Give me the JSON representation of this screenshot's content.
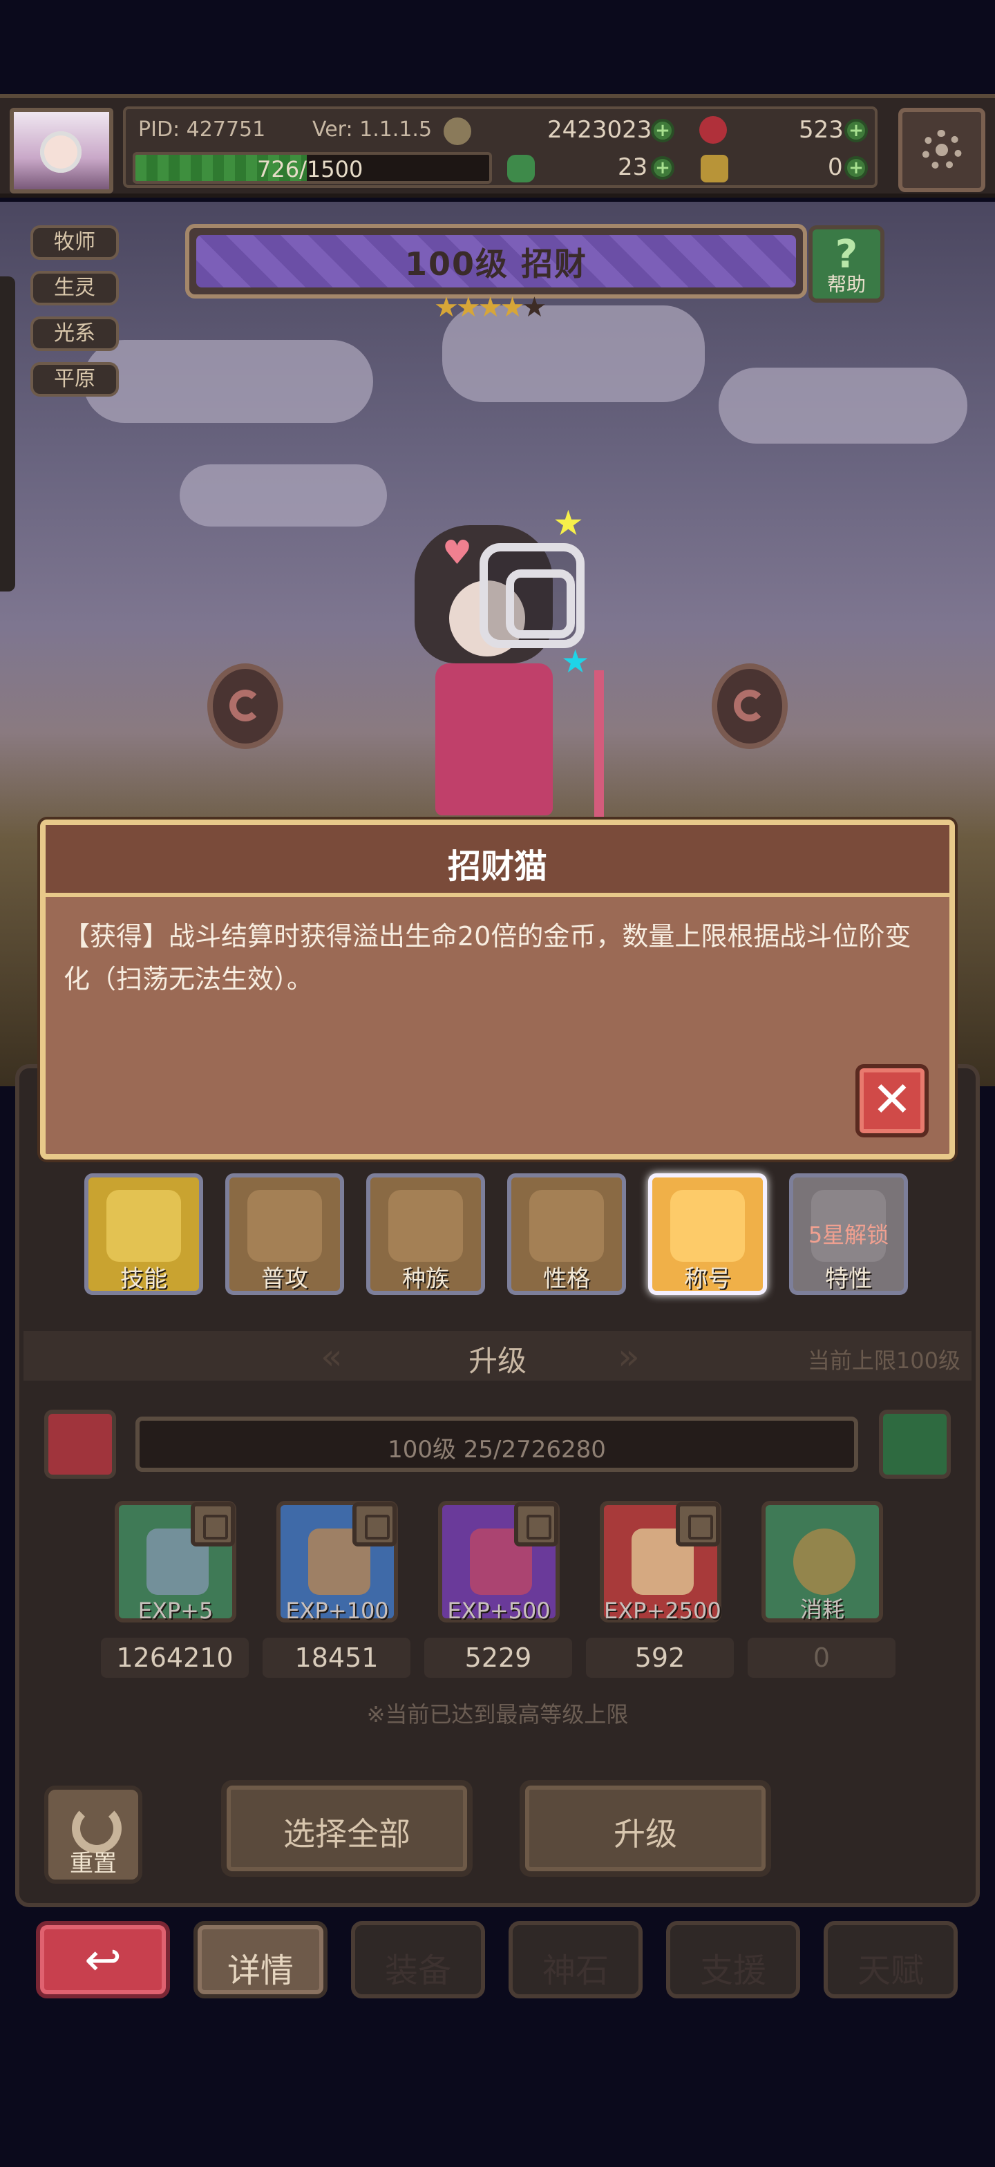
{
  "header": {
    "pid": "PID: 427751",
    "version": "Ver: 1.1.1.5",
    "gold": "2423023",
    "gems": "523",
    "clover": "23",
    "keys": "0",
    "exp_text": "726/1500",
    "exp_fraction": 0.484
  },
  "scene": {
    "tags": [
      "牧师",
      "生灵",
      "光系",
      "平原"
    ],
    "title": "100级 招财",
    "stars_filled": "★★★★",
    "stars_empty": "★",
    "help_label": "帮助",
    "help_icon": "?"
  },
  "popup": {
    "title": "招财猫",
    "body": "【获得】战斗结算时获得溢出生命20倍的金币，数量上限根据战斗位阶变化（扫荡无法生效）。",
    "close_icon": "✕"
  },
  "categories": [
    {
      "label": "技能",
      "color": "#c9a330"
    },
    {
      "label": "普攻",
      "color": "#8a6a44"
    },
    {
      "label": "种族",
      "color": "#8a6a44"
    },
    {
      "label": "性格",
      "color": "#8a6a44"
    },
    {
      "label": "称号",
      "color": "#f0b048"
    },
    {
      "label": "特性",
      "color": "#7a7478",
      "lock": "5星解锁"
    }
  ],
  "upgrade": {
    "section_title": "升级",
    "limit": "当前上限100级",
    "level_text": "100级 25/2726280",
    "items": [
      {
        "exp": "EXP+5",
        "count": "1264210",
        "color": "#3f7a56"
      },
      {
        "exp": "EXP+100",
        "count": "18451",
        "color": "#3f6aa8"
      },
      {
        "exp": "EXP+500",
        "count": "5229",
        "color": "#6a3a9a"
      },
      {
        "exp": "EXP+2500",
        "count": "592",
        "color": "#a83a3a"
      },
      {
        "exp": "消耗",
        "count": "0",
        "color": "#3f7a56"
      }
    ],
    "notice": "※当前已达到最高等级上限",
    "reset_label": "重置",
    "select_all": "选择全部",
    "upgrade_btn": "升级"
  },
  "nav": {
    "back_icon": "↩",
    "items": [
      "详情",
      "装备",
      "神石",
      "支援",
      "天赋"
    ]
  }
}
